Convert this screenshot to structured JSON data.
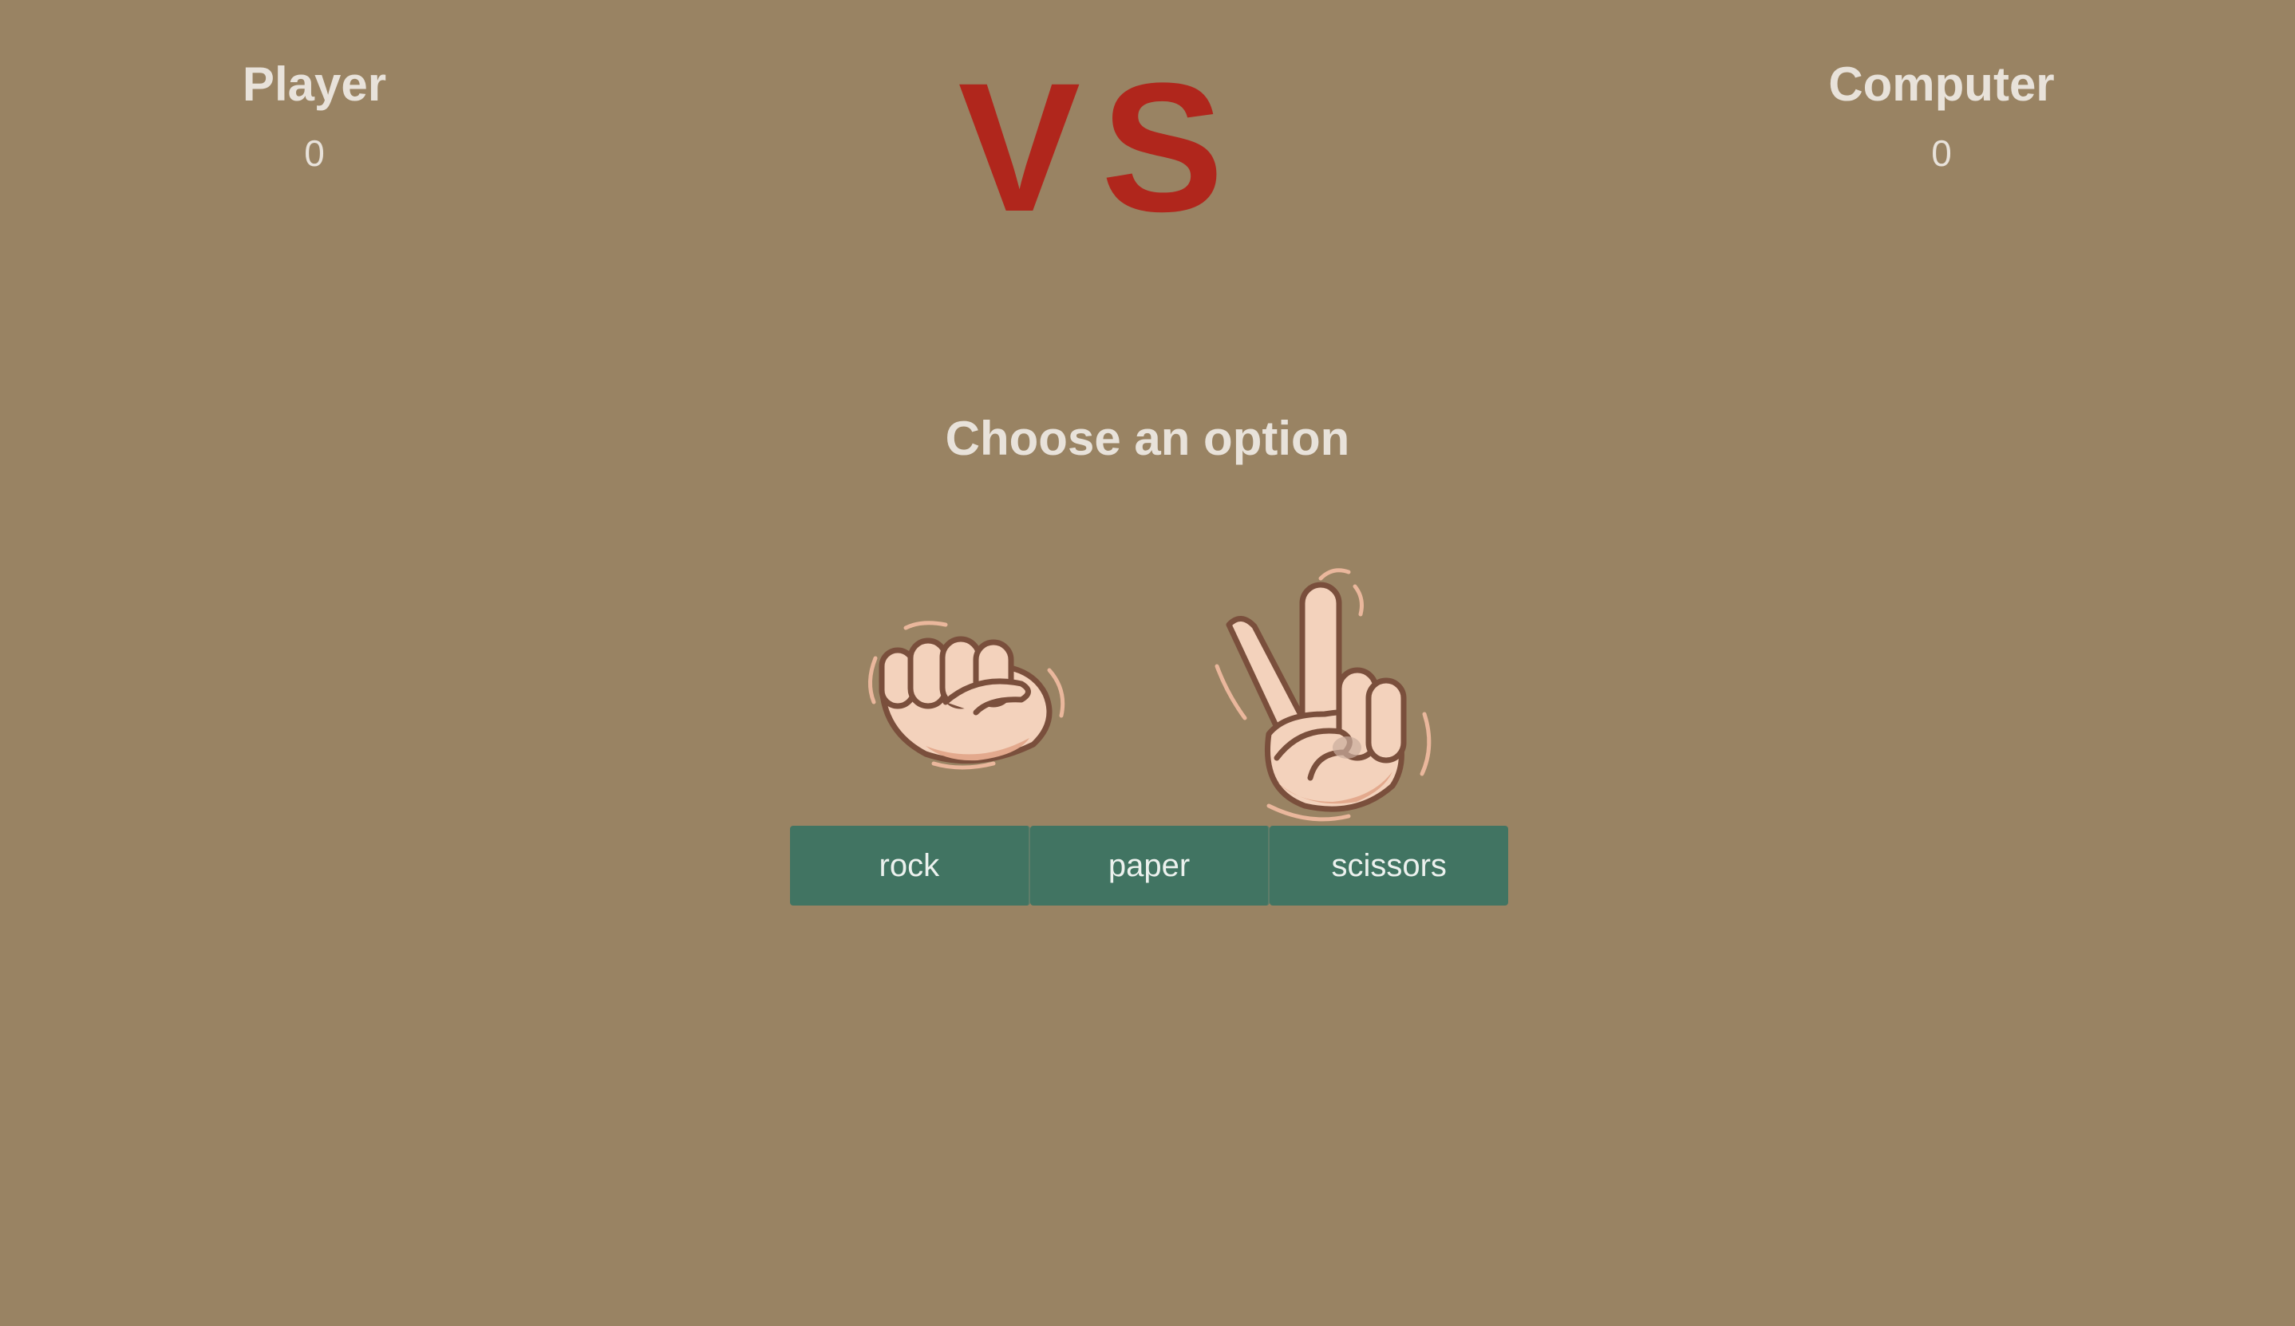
{
  "player": {
    "name": "Player",
    "score": "0"
  },
  "computer": {
    "name": "Computer",
    "score": "0"
  },
  "vs_label": "VS",
  "prompt": "Choose an option",
  "options": [
    {
      "label": "rock"
    },
    {
      "label": "paper"
    },
    {
      "label": "scissors"
    }
  ],
  "hands": {
    "rock": "fist-hand-icon",
    "scissors": "victory-hand-icon"
  },
  "colors": {
    "background": "#998363",
    "vs": "#b0261c",
    "button": "#417462",
    "text": "#e8e2da",
    "skin": "#f3d2bc",
    "outline": "#7a4f3c"
  }
}
